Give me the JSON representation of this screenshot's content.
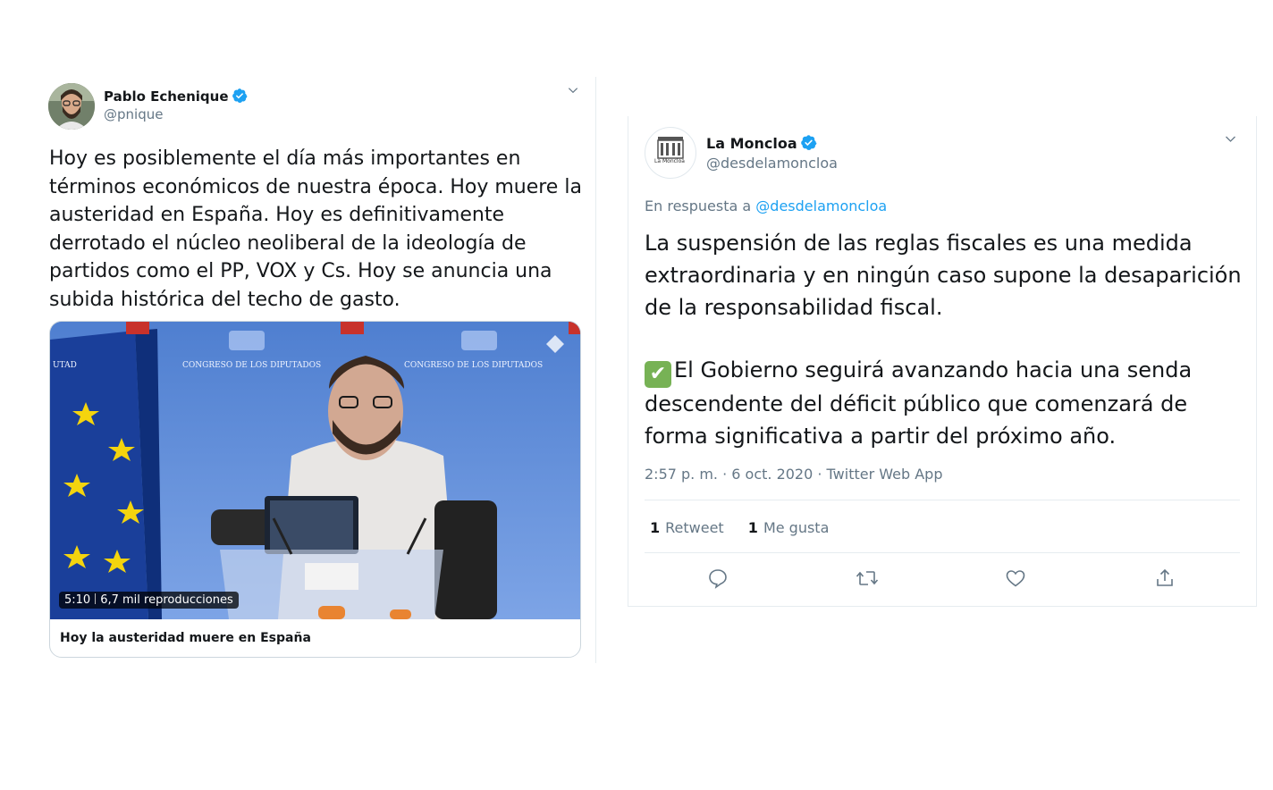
{
  "left_tweet": {
    "author_name": "Pablo Echenique",
    "author_handle": "@pnique",
    "text": "Hoy es posiblemente el día más importantes en términos económicos de nuestra época. Hoy muere la austeridad en España. Hoy es definitivamente derrotado el núcleo neoliberal de la ideología de partidos como el PP, VOX y Cs. Hoy se anuncia una subida histórica del techo de gasto.",
    "video": {
      "duration": "5:10",
      "views": "6,7 mil reproducciones",
      "backdrop_label": "CONGRESO DE LOS DIPUTADOS",
      "backdrop_label_cut": "UTAD"
    },
    "card_title": "Hoy la austeridad muere en España"
  },
  "right_tweet": {
    "author_name": "La Moncloa",
    "author_handle": "@desdelamoncloa",
    "avatar_label": "La Moncloa",
    "reply_prefix": "En respuesta a",
    "reply_handle": "@desdelamoncloa",
    "paragraph1": "La suspensión de las reglas fiscales es una medida extraordinaria y en ningún caso supone la desaparición de la responsabilidad fiscal.",
    "paragraph2_emoji": "✔",
    "paragraph2": "El Gobierno seguirá avanzando hacia una senda descendente del déficit público que comenzará de forma significativa a partir del próximo año.",
    "meta": "2:57 p. m. · 6 oct. 2020 · Twitter Web App",
    "retweets_count": "1",
    "retweets_label": "Retweet",
    "likes_count": "1",
    "likes_label": "Me gusta"
  },
  "colors": {
    "verified": "#1da1f2",
    "link": "#1da1f2",
    "muted": "#657786",
    "check": "#77b255",
    "video_backdrop": "#5b8ad8"
  },
  "icons": {
    "verified": "verified-badge-icon",
    "chevron": "chevron-down-icon",
    "reply": "reply-icon",
    "retweet": "retweet-icon",
    "like": "heart-icon",
    "share": "share-icon"
  }
}
